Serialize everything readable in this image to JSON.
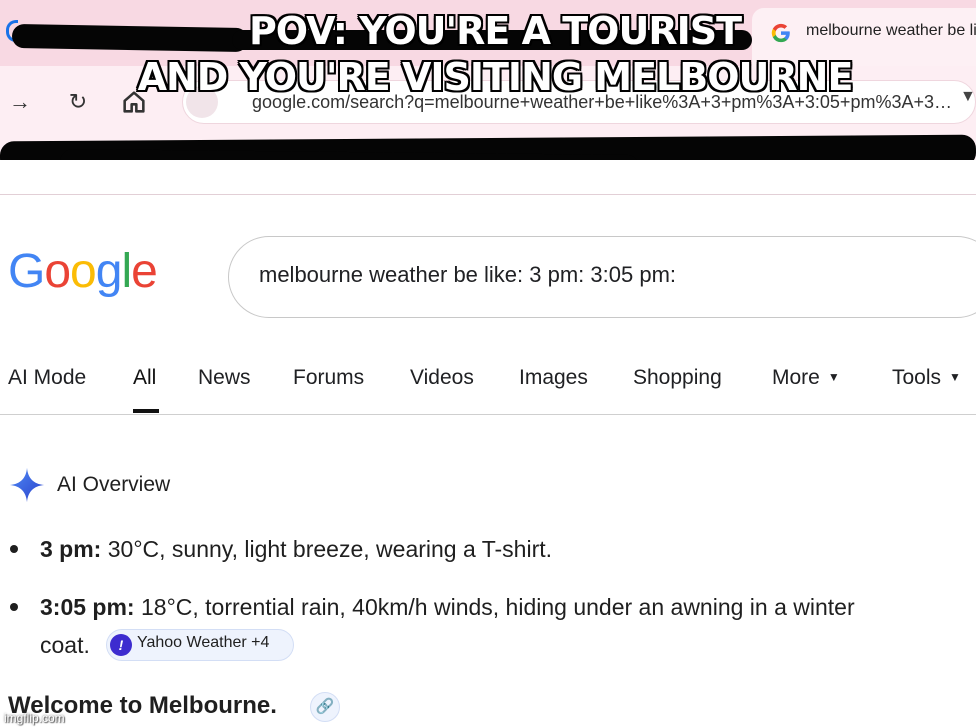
{
  "browser": {
    "active_tab_title": "melbourne weather be like",
    "url_text": "google.com/search?q=melbourne+weather+be+like%3A+3+pm%3A+3:05+pm%3A+3…",
    "icons": [
      "back-arrow-icon",
      "reload-icon",
      "home-icon",
      "google-favicon",
      "chevron-down-icon"
    ]
  },
  "meme": {
    "line1": "POV: YOU'RE A TOURIST",
    "line2": "AND YOU'RE VISITING MELBOURNE"
  },
  "google": {
    "logo_letters": [
      "G",
      "o",
      "o",
      "g",
      "l",
      "e"
    ],
    "logo_colors": [
      "#4285F4",
      "#EA4335",
      "#FBBC05",
      "#4285F4",
      "#34A853",
      "#EA4335"
    ],
    "search_query": "melbourne weather be like: 3 pm: 3:05 pm:",
    "tabs": [
      "AI Mode",
      "All",
      "News",
      "Forums",
      "Videos",
      "Images",
      "Shopping",
      "More",
      "Tools"
    ],
    "active_tab": "All"
  },
  "ai_overview": {
    "title": "AI Overview",
    "items": [
      {
        "label": "3 pm:",
        "text": " 30°C, sunny, light breeze, wearing a T-shirt."
      },
      {
        "label": "3:05 pm:",
        "text": " 18°C, torrential rain, 40km/h winds, hiding under an awning in a winter",
        "text2": "coat."
      }
    ],
    "source_chip": "Yahoo Weather +4",
    "closing": "Welcome to Melbourne."
  },
  "watermark": "imgflip.com"
}
